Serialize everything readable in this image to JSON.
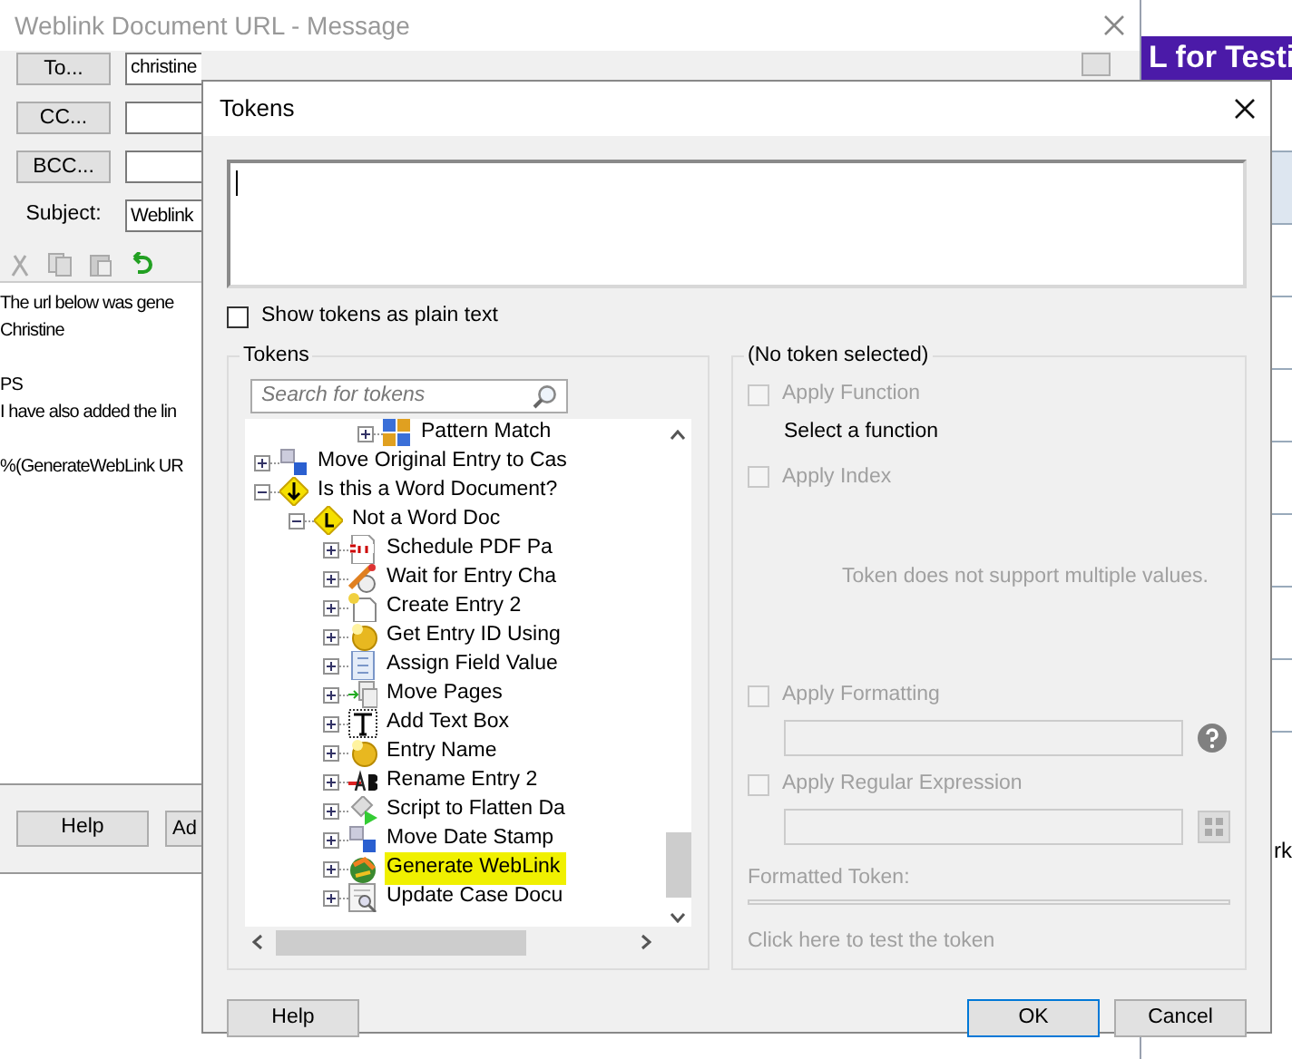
{
  "message_window": {
    "title": "Weblink Document URL - Message",
    "recipients": [
      {
        "button": "To...",
        "value": "christine"
      },
      {
        "button": "CC..."
      },
      {
        "button": "BCC..."
      }
    ],
    "subject": {
      "label": "Subject:",
      "value": "Weblink"
    },
    "body_paragraphs": [
      [
        "The url below was gene",
        "Christine"
      ],
      [
        "PS",
        "I have also added the lin"
      ],
      [
        "%(GenerateWebLink UR"
      ]
    ],
    "buttons": [
      "Help",
      "Ad"
    ]
  },
  "background_window": {
    "header": "L for Testi",
    "cell": "rk"
  },
  "tokens_dialog": {
    "title": "Tokens",
    "show_plain_text": {
      "label": "Show tokens as plain text",
      "checked": false
    },
    "tree_group": {
      "title": "Tokens",
      "search_placeholder": "Search for tokens",
      "items": [
        {
          "children": [
            {
              "children": [
                {
                  "children": [
                    {
                      "label": "Pattern Match",
                      "kind": "pattern",
                      "expanded": false,
                      "highlighted": false
                    }
                  ]
                }
              ]
            }
          ]
        },
        {
          "label": "Move Original Entry to Cas",
          "kind": "move",
          "expanded": false,
          "highlighted": false
        },
        {
          "label": "Is this a Word Document?",
          "kind": "decision",
          "expanded": true,
          "highlighted": false,
          "children": [
            {
              "label": "Not a Word Doc",
              "kind": "branch",
              "expanded": true,
              "highlighted": false,
              "children": [
                {
                  "label": "Schedule PDF Pa",
                  "kind": "pdf",
                  "expanded": false,
                  "highlighted": false
                },
                {
                  "label": "Wait for Entry Cha",
                  "kind": "wait",
                  "expanded": false,
                  "highlighted": false
                },
                {
                  "label": "Create Entry 2",
                  "kind": "create",
                  "expanded": false,
                  "highlighted": false
                },
                {
                  "label": "Get Entry ID Using",
                  "kind": "coin",
                  "expanded": false,
                  "highlighted": false
                },
                {
                  "label": "Assign Field Value",
                  "kind": "field",
                  "expanded": false,
                  "highlighted": false
                },
                {
                  "label": "Move Pages",
                  "kind": "pages",
                  "expanded": false,
                  "highlighted": false
                },
                {
                  "label": "Add Text Box",
                  "kind": "textbox",
                  "expanded": false,
                  "highlighted": false
                },
                {
                  "label": "Entry Name",
                  "kind": "coin",
                  "expanded": false,
                  "highlighted": false
                },
                {
                  "label": "Rename Entry 2",
                  "kind": "rename",
                  "expanded": false,
                  "highlighted": false
                },
                {
                  "label": "Script to Flatten Da",
                  "kind": "script",
                  "expanded": false,
                  "highlighted": false
                },
                {
                  "label": "Move Date Stamp",
                  "kind": "move",
                  "expanded": false,
                  "highlighted": false
                },
                {
                  "label": "Generate WebLink",
                  "kind": "weblink",
                  "expanded": false,
                  "highlighted": true
                },
                {
                  "label": "Update Case Docu",
                  "kind": "update",
                  "expanded": false,
                  "highlighted": false
                }
              ]
            }
          ]
        }
      ]
    },
    "options_group": {
      "title": "(No token selected)",
      "apply_function": {
        "label": "Apply Function",
        "checked": false,
        "disabled": true
      },
      "function_hint": "Select a function",
      "apply_index": {
        "label": "Apply Index",
        "checked": false,
        "disabled": true
      },
      "index_message": "Token does not support multiple values.",
      "apply_formatting": {
        "label": "Apply Formatting",
        "checked": false,
        "disabled": true
      },
      "apply_regex": {
        "label": "Apply Regular Expression",
        "checked": false,
        "disabled": true
      },
      "formatted_token_label": "Formatted Token:",
      "test_link": "Click here to test the token"
    },
    "buttons": [
      "Help",
      "OK",
      "Cancel"
    ]
  }
}
